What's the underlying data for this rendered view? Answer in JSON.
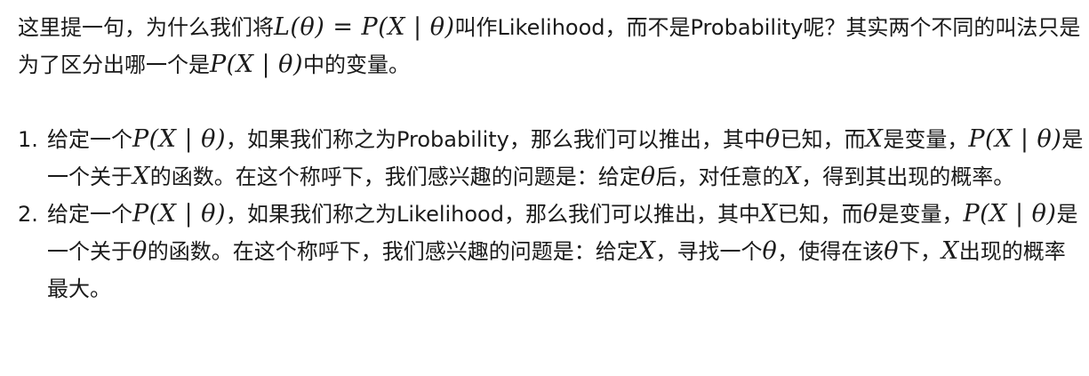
{
  "intro": {
    "t1": "这里提一句，为什么我们将",
    "m1": "L(θ) = P(X | θ)",
    "t2": "叫作Likelihood，而不是Probability呢？其实两个不同的叫法只是为了区分出哪一个是",
    "m2": "P(X | θ)",
    "t3": "中的变量。"
  },
  "items": [
    {
      "number": "1.",
      "t1": "给定一个",
      "m1": "P(X | θ)",
      "t2": "，如果我们称之为Probability，那么我们可以推出，其中",
      "m2": "θ",
      "t3": "已知，而",
      "m3": "X",
      "t4": "是变量，",
      "m4": "P(X | θ)",
      "t5": "是一个关于",
      "m5": "X",
      "t6": "的函数。在这个称呼下，我们感兴趣的问题是：给定",
      "m6": "θ",
      "t7": "后，对任意的",
      "m7": "X",
      "t8": "，得到其出现的概率。"
    },
    {
      "number": "2.",
      "t1": "给定一个",
      "m1": "P(X | θ)",
      "t2": "，如果我们称之为Likelihood，那么我们可以推出，其中",
      "m2": "X",
      "t3": "已知，而",
      "m3": "θ",
      "t4": "是变量，",
      "m4": "P(X | θ)",
      "t5": "是一个关于",
      "m5": "θ",
      "t6": "的函数。在这个称呼下，我们感兴趣的问题是：给定",
      "m6": "X",
      "t7": "，寻找一个",
      "m7": "θ",
      "t8": "，使得在该",
      "m8": "θ",
      "t9": "下，",
      "m9": "X",
      "t10": "出现的概率最大。"
    }
  ]
}
